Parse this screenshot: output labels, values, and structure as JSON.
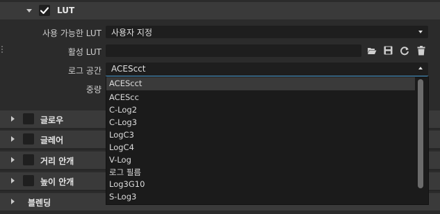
{
  "lut_section": {
    "title": "LUT",
    "enabled": true,
    "rows": {
      "available_lut": {
        "label": "사용 가능한 LUT",
        "value": "사용자 지정"
      },
      "active_lut": {
        "label": "활성 LUT",
        "value": ""
      },
      "log_space": {
        "label": "로그 공간",
        "value": "ACEScct"
      },
      "intensity": {
        "label": "중량"
      }
    }
  },
  "log_space_dropdown": {
    "options": [
      "ACEScct",
      "ACEScc",
      "C-Log2",
      "C-Log3",
      "LogC3",
      "LogC4",
      "V-Log",
      "로그 필름",
      "Log3G10",
      "S-Log3"
    ],
    "selected": "ACEScct"
  },
  "icons": [
    "folder-open-icon",
    "save-icon",
    "refresh-icon",
    "trash-icon"
  ],
  "sections": [
    {
      "title": "글로우",
      "has_checkbox": true
    },
    {
      "title": "글레어",
      "has_checkbox": true
    },
    {
      "title": "거리 안개",
      "has_checkbox": true
    },
    {
      "title": "높이 안개",
      "has_checkbox": true
    },
    {
      "title": "블렌딩",
      "has_checkbox": false
    }
  ],
  "colors": {
    "accent": "#4fa3d8",
    "panel": "#2b2b2b",
    "header": "#3a3a3a"
  }
}
